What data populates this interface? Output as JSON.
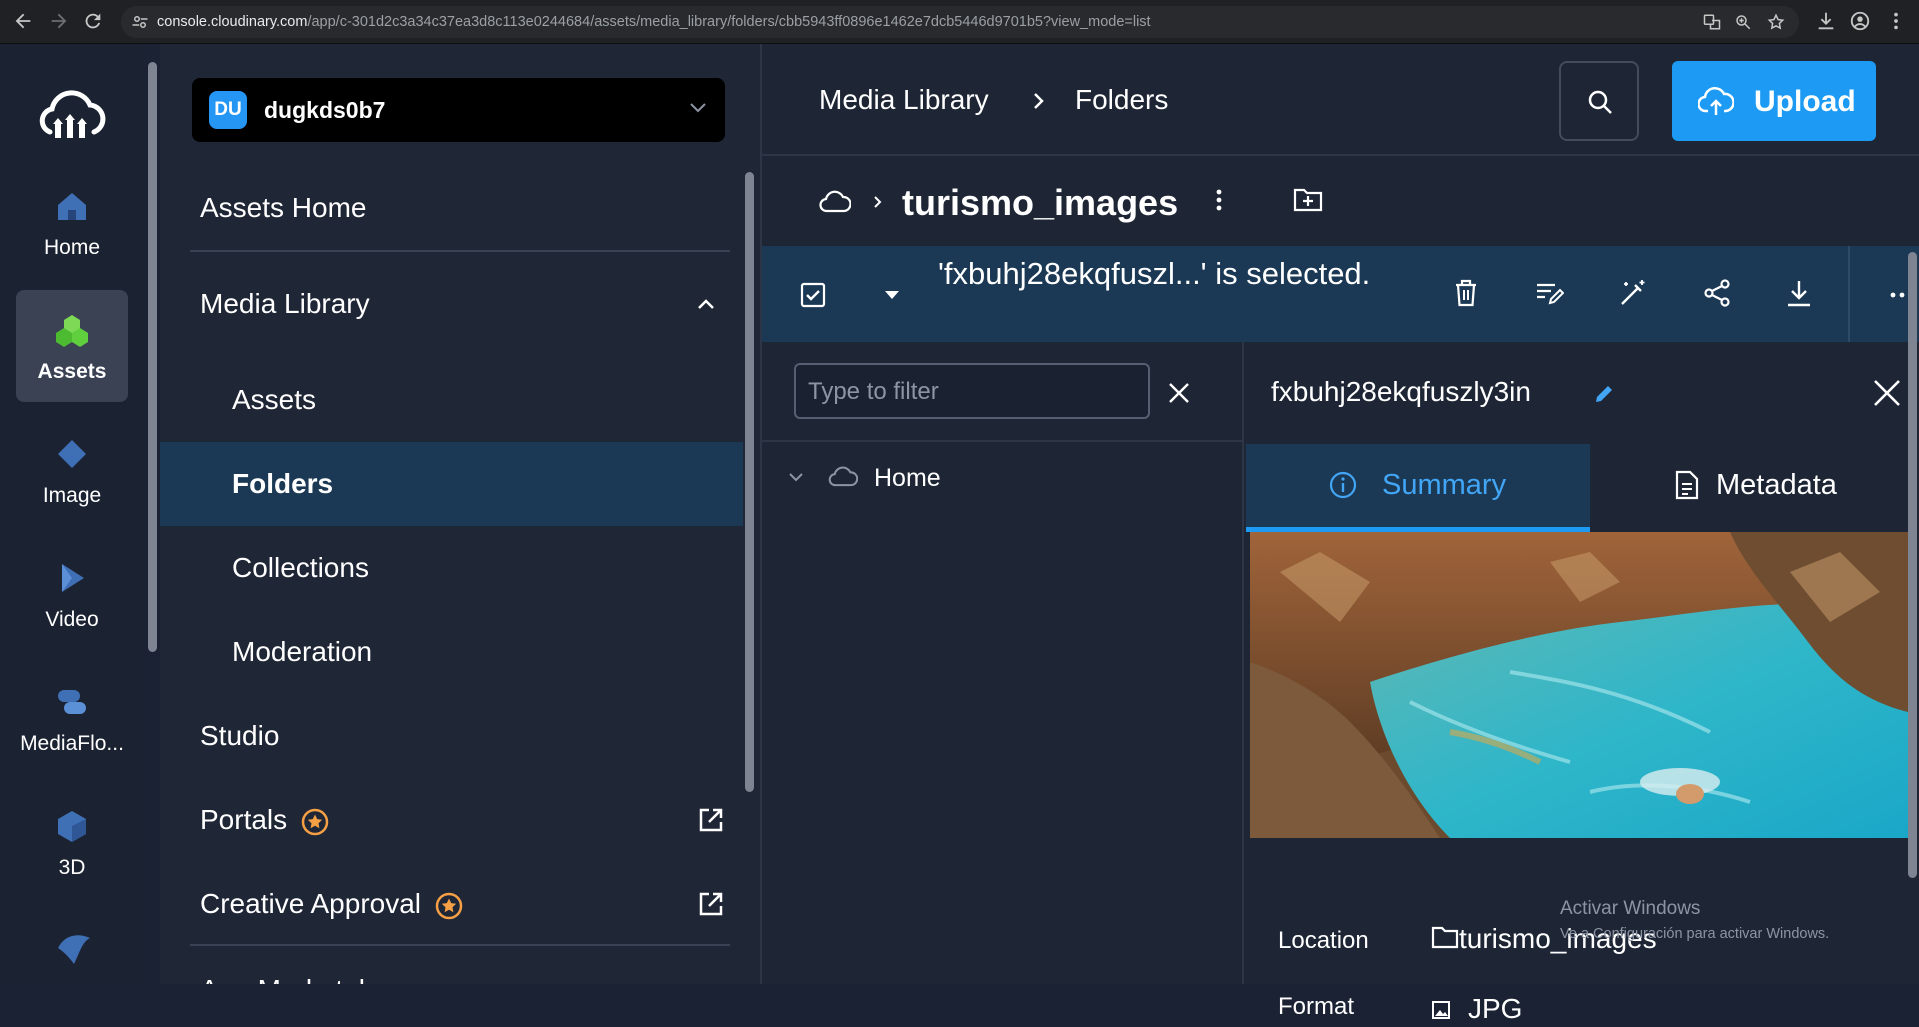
{
  "browser": {
    "url_host": "console.cloudinary.com",
    "url_path": "/app/c-301d2c3a34c37ea3d8c113e0244684/assets/media_library/folders/cbb5943ff0896e1462e7dcb5446d9701b5?view_mode=list"
  },
  "rail": {
    "items": [
      {
        "label": "Home",
        "icon": "home-icon"
      },
      {
        "label": "Assets",
        "icon": "assets-icon"
      },
      {
        "label": "Image",
        "icon": "image-icon"
      },
      {
        "label": "Video",
        "icon": "video-icon"
      },
      {
        "label": "MediaFlo...",
        "icon": "mediaflows-icon"
      },
      {
        "label": "3D",
        "icon": "cube-icon"
      }
    ]
  },
  "sidebar": {
    "workspace": {
      "badge": "DU",
      "name": "dugkds0b7"
    },
    "assets_home": "Assets Home",
    "media_library": "Media Library",
    "sub_items": [
      "Assets",
      "Folders",
      "Collections",
      "Moderation"
    ],
    "studio": "Studio",
    "portals": "Portals",
    "creative_approval": "Creative Approval",
    "app_marketplace": "App Marketplace"
  },
  "header": {
    "crumb1": "Media Library",
    "crumb2": "Folders",
    "upload_label": "Upload"
  },
  "folder": {
    "name": "turismo_images"
  },
  "selection": {
    "text": "'fxbuhj28ekqfuszl...' is selected."
  },
  "tree": {
    "filter_placeholder": "Type to filter",
    "home_label": "Home"
  },
  "detail": {
    "title": "fxbuhj28ekqfuszly3in",
    "tab_summary": "Summary",
    "tab_metadata": "Metadata",
    "location_label": "Location",
    "location_value": "turismo_images",
    "format_label": "Format",
    "format_value": "JPG"
  },
  "watermark": {
    "line1": "Activar Windows",
    "line2": "Ve a Configuración para activar Windows."
  },
  "colors": {
    "accent": "#1c9af4",
    "selected_bg": "#1b3954",
    "rail_bg": "#1b2231"
  }
}
